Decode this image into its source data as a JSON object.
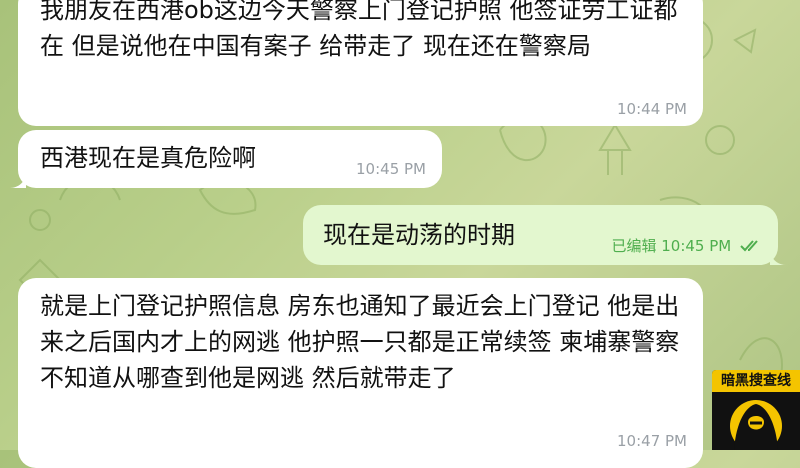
{
  "chat": {
    "messages": [
      {
        "direction": "incoming",
        "text": "我朋友在西港ob这边今天警察上门登记护照 他签证劳工证都在 但是说他在中国有案子 给带走了 现在还在警察局",
        "time": "10:44 PM"
      },
      {
        "direction": "incoming",
        "text": "西港现在是真危险啊",
        "time": "10:45 PM"
      },
      {
        "direction": "outgoing",
        "text": "现在是动荡的时期",
        "edited_label": "已编辑",
        "time": "10:45 PM",
        "status_icon": "double-check-icon"
      },
      {
        "direction": "incoming",
        "text": "就是上门登记护照信息 房东也通知了最近会上门登记 他是出来之后国内才上的网逃 他护照一只都是正常续签 柬埔寨警察不知道从哪查到他是网逃 然后就带走了",
        "time": "10:47 PM"
      }
    ]
  },
  "watermark": {
    "text": "暗黑搜查线",
    "icon": "hooded-figure-icon",
    "colors": {
      "band": "#f4c400",
      "background": "#111111"
    }
  },
  "colors": {
    "incoming_bubble": "#ffffff",
    "outgoing_bubble": "#e3f7cf",
    "outgoing_meta": "#4fae4e",
    "timestamp": "#9aa0a6"
  }
}
